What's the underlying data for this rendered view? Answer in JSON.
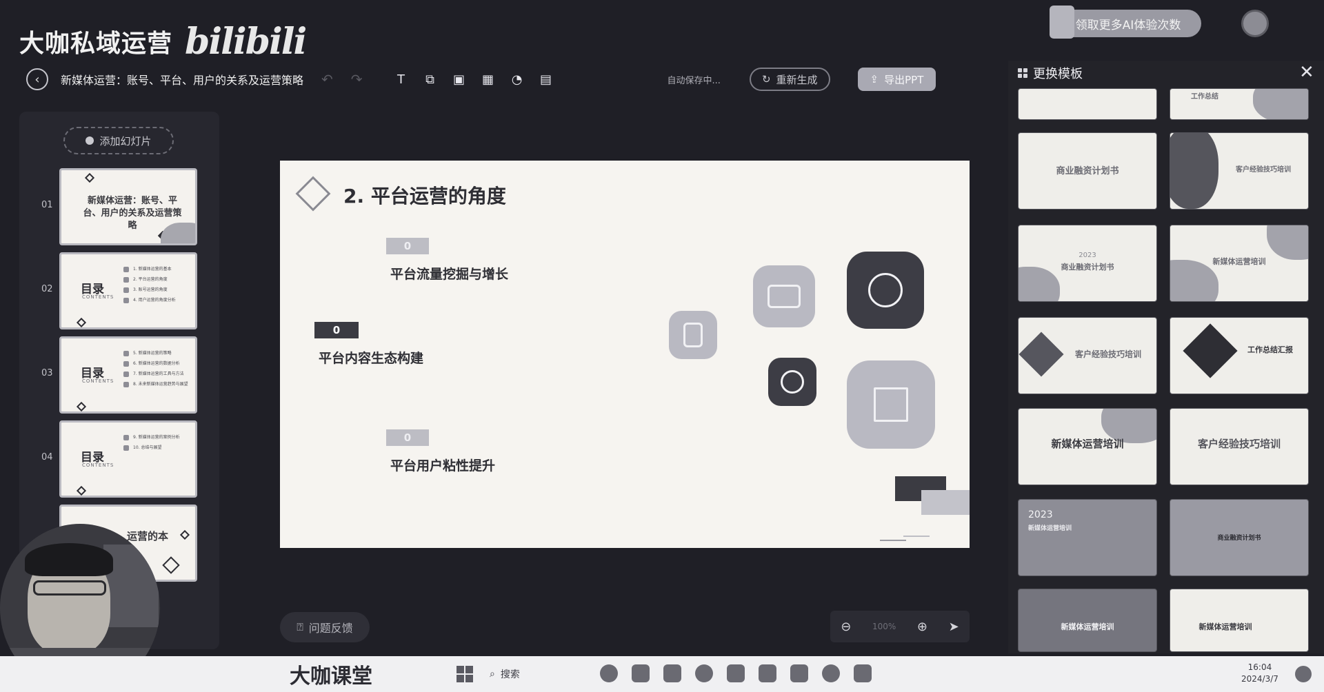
{
  "brand": {
    "title": "大咖私域运营",
    "logo": "bilibili"
  },
  "promo": {
    "label": "领取更多AI体验次数"
  },
  "toolbar": {
    "doc_title": "新媒体运营：账号、平台、用户的关系及运营策略",
    "autosave": "自动保存中...",
    "regenerate": "重新生成",
    "export": "导出PPT"
  },
  "left_panel": {
    "add_slide": "添加幻灯片",
    "slides": [
      {
        "num": "01",
        "title": "新媒体运营：账号、平台、用户的关系及运营策略"
      },
      {
        "num": "02",
        "title": "目录",
        "sub": "CONTENTS",
        "items": [
          "1. 新媒体运营的基本",
          "2. 平台运营的角度",
          "3. 账号运营的角度",
          "4. 用户运营的角度分析"
        ]
      },
      {
        "num": "03",
        "title": "目录",
        "sub": "CONTENTS",
        "items": [
          "5. 新媒体运营的策略",
          "6. 新媒体运营的数据分析",
          "7. 新媒体运营的工具与方法",
          "8. 未来新媒体运营趋势与展望"
        ]
      },
      {
        "num": "04",
        "title": "目录",
        "sub": "CONTENTS",
        "items": [
          "9. 新媒体运营的案例分析",
          "10. 总结与展望"
        ]
      },
      {
        "num": "05",
        "title": "运营的本"
      }
    ]
  },
  "slide": {
    "title": "2. 平台运营的角度",
    "points": [
      {
        "num": "0",
        "label": "平台流量挖掘与增长"
      },
      {
        "num": "0",
        "label": "平台内容生态构建"
      },
      {
        "num": "0",
        "label": "平台用户粘性提升"
      }
    ]
  },
  "bottom": {
    "feedback": "问题反馈",
    "zoom": "100%"
  },
  "right_panel": {
    "title": "更换模板",
    "templates": [
      {
        "label": ""
      },
      {
        "label": "工作总结"
      },
      {
        "label": "商业融资计划书"
      },
      {
        "label": "客户经验技巧培训"
      },
      {
        "label": "商业融资计划书",
        "sub": "2023"
      },
      {
        "label": "新媒体运营培训"
      },
      {
        "label": "客户经验技巧培训"
      },
      {
        "label": "工作总结汇报"
      },
      {
        "label": "新媒体运营培训"
      },
      {
        "label": "客户经验技巧培训"
      },
      {
        "label": "新媒体运营培训",
        "sub": "2023"
      },
      {
        "label": "商业融资计划书"
      },
      {
        "label": "新媒体运营培训"
      },
      {
        "label": "新媒体运营培训"
      }
    ]
  },
  "taskbar": {
    "brand": "大咖课堂",
    "search": "搜索",
    "time": "16:04",
    "date": "2024/3/7"
  }
}
